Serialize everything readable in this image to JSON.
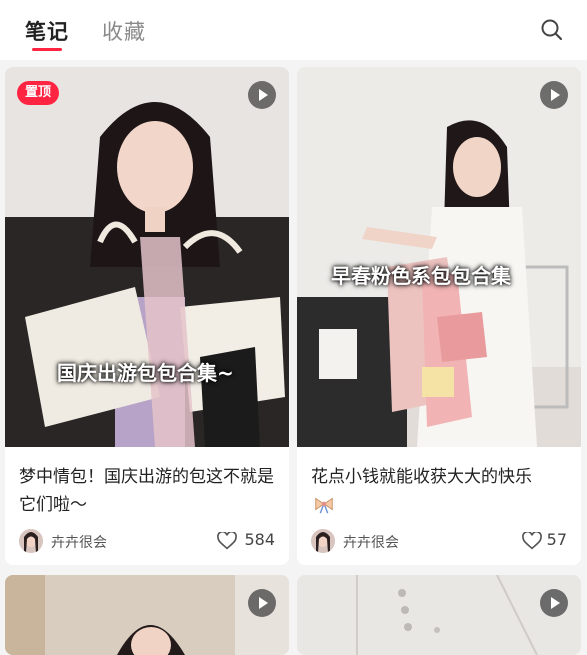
{
  "tabs": {
    "notes": "笔记",
    "favorites": "收藏"
  },
  "icons": {
    "search": "search-icon",
    "play": "play-icon",
    "heart": "heart-icon"
  },
  "colors": {
    "accent": "#ff2442"
  },
  "cards": [
    {
      "pin_badge": "置顶",
      "overlay_text": "国庆出游包包合集~",
      "title": "梦中情包！国庆出游的包这不就是它们啦～",
      "author": "卉卉很会",
      "likes": "584"
    },
    {
      "overlay_text": "早春粉色系包包合集",
      "title": "花点小钱就能收获大大的快乐",
      "author": "卉卉很会",
      "likes": "57",
      "title_icon": "bow-emoji-icon"
    },
    {},
    {}
  ]
}
